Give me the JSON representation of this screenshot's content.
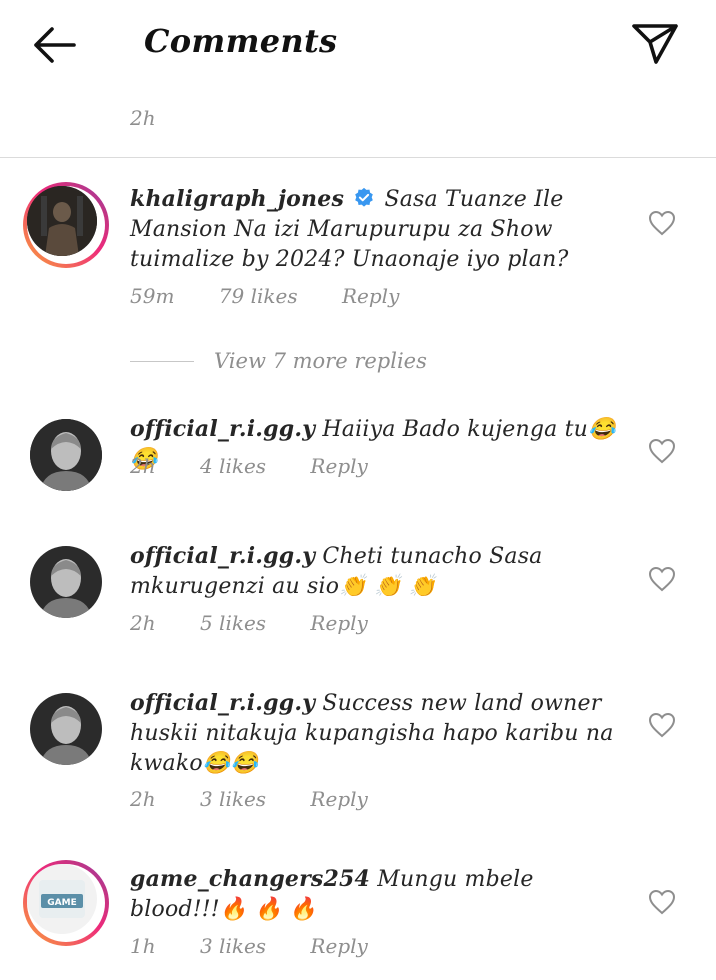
{
  "header": {
    "title": "Comments"
  },
  "previous_comment": {
    "time": "2h"
  },
  "comments": [
    {
      "username": "khaligraph_jones",
      "verified": true,
      "text": "Sasa Tuanze Ile Mansion Na izi Marupurupu za Show tuimalize by 2024? Unaonaje iyo plan?",
      "time": "59m",
      "likes": "79 likes",
      "reply": "Reply"
    },
    {
      "username": "official_r.i.gg.y",
      "verified": false,
      "text": "Haiiya Bado kujenga tu😂😂",
      "time": "2h",
      "likes": "4 likes",
      "reply": "Reply"
    },
    {
      "username": "official_r.i.gg.y",
      "verified": false,
      "text": "Cheti tunacho Sasa mkurugenzi au sio👏 👏 👏",
      "time": "2h",
      "likes": "5 likes",
      "reply": "Reply"
    },
    {
      "username": "official_r.i.gg.y",
      "verified": false,
      "text": "Success new land owner huskii nitakuja kupangisha hapo karibu na kwako😂😂",
      "time": "2h",
      "likes": "3 likes",
      "reply": "Reply"
    },
    {
      "username": "game_changers254",
      "verified": false,
      "text": "Mungu mbele blood!!!🔥 🔥 🔥",
      "time": "1h",
      "likes": "3 likes",
      "reply": "Reply"
    }
  ],
  "view_more": {
    "label": "View 7 more replies"
  },
  "icons": {
    "back": "arrow-left-icon",
    "send": "paper-plane-icon",
    "like": "heart-outline-icon",
    "verified": "verified-badge-icon"
  },
  "colors": {
    "verified_blue": "#3897f0",
    "meta_gray": "#8e8e8e",
    "story_ring_start": "#f9a43a",
    "story_ring_end": "#8a3ab9"
  }
}
